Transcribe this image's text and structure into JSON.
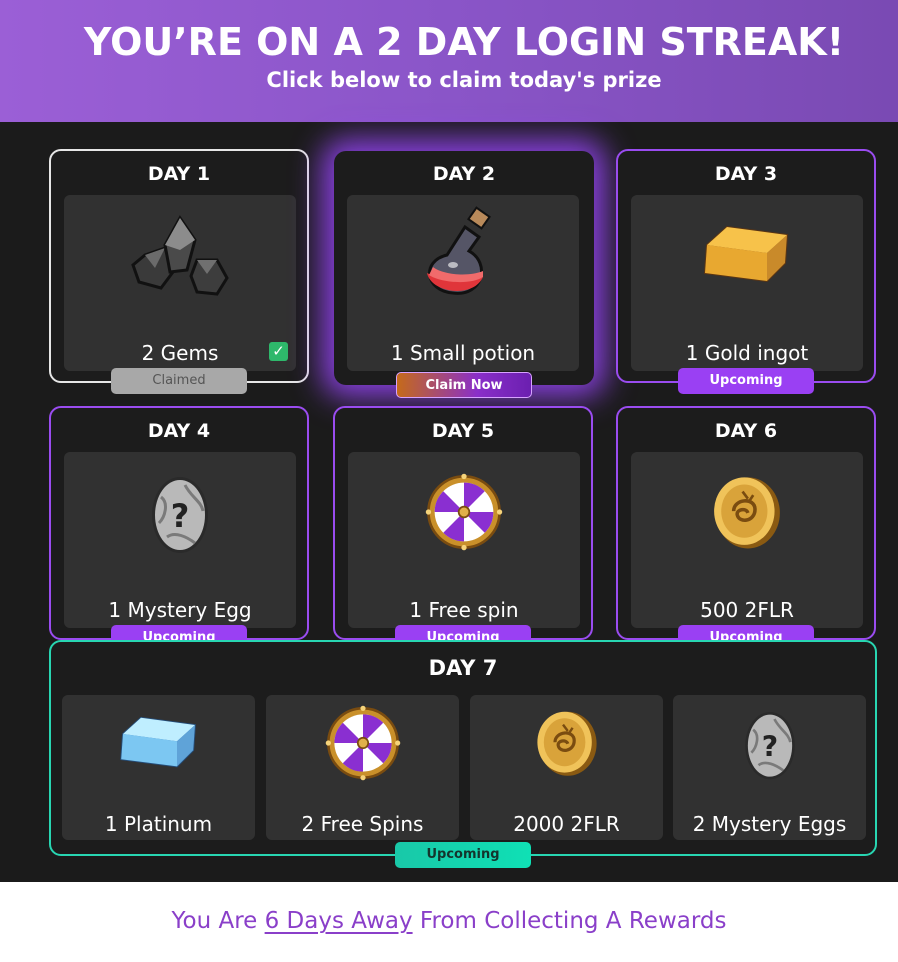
{
  "header": {
    "title": "YOU’RE ON A 2 DAY LOGIN STREAK!",
    "subtitle": "Click below to claim today's prize"
  },
  "days": [
    {
      "day": "DAY 1",
      "item": "2 Gems",
      "status": "Claimed",
      "icon": "gems-icon"
    },
    {
      "day": "DAY 2",
      "item": "1 Small potion",
      "status": "Claim Now",
      "icon": "potion-icon"
    },
    {
      "day": "DAY 3",
      "item": "1 Gold ingot",
      "status": "Upcoming",
      "icon": "gold-ingot-icon"
    },
    {
      "day": "DAY 4",
      "item": "1 Mystery Egg",
      "status": "Upcoming",
      "icon": "mystery-egg-icon"
    },
    {
      "day": "DAY 5",
      "item": "1 Free spin",
      "status": "Upcoming",
      "icon": "spin-wheel-icon"
    },
    {
      "day": "DAY 6",
      "item": "500 2FLR",
      "status": "Upcoming",
      "icon": "coin-icon"
    }
  ],
  "day7": {
    "day": "DAY 7",
    "status": "Upcoming",
    "items": [
      {
        "item": "1 Platinum",
        "icon": "platinum-ingot-icon"
      },
      {
        "item": "2 Free Spins",
        "icon": "spin-wheel-icon"
      },
      {
        "item": "2000 2FLR",
        "icon": "coin-icon"
      },
      {
        "item": "2 Mystery Eggs",
        "icon": "mystery-egg-icon"
      }
    ]
  },
  "footer": {
    "prefix": "You Are ",
    "away": "6 Days Away",
    "suffix": " From Collecting A Rewards"
  },
  "colors": {
    "accent": "#9a40f3",
    "day7_accent": "#28d6b2",
    "claimed_check": "#2eb86b",
    "footer_text": "#8a3fc9"
  }
}
